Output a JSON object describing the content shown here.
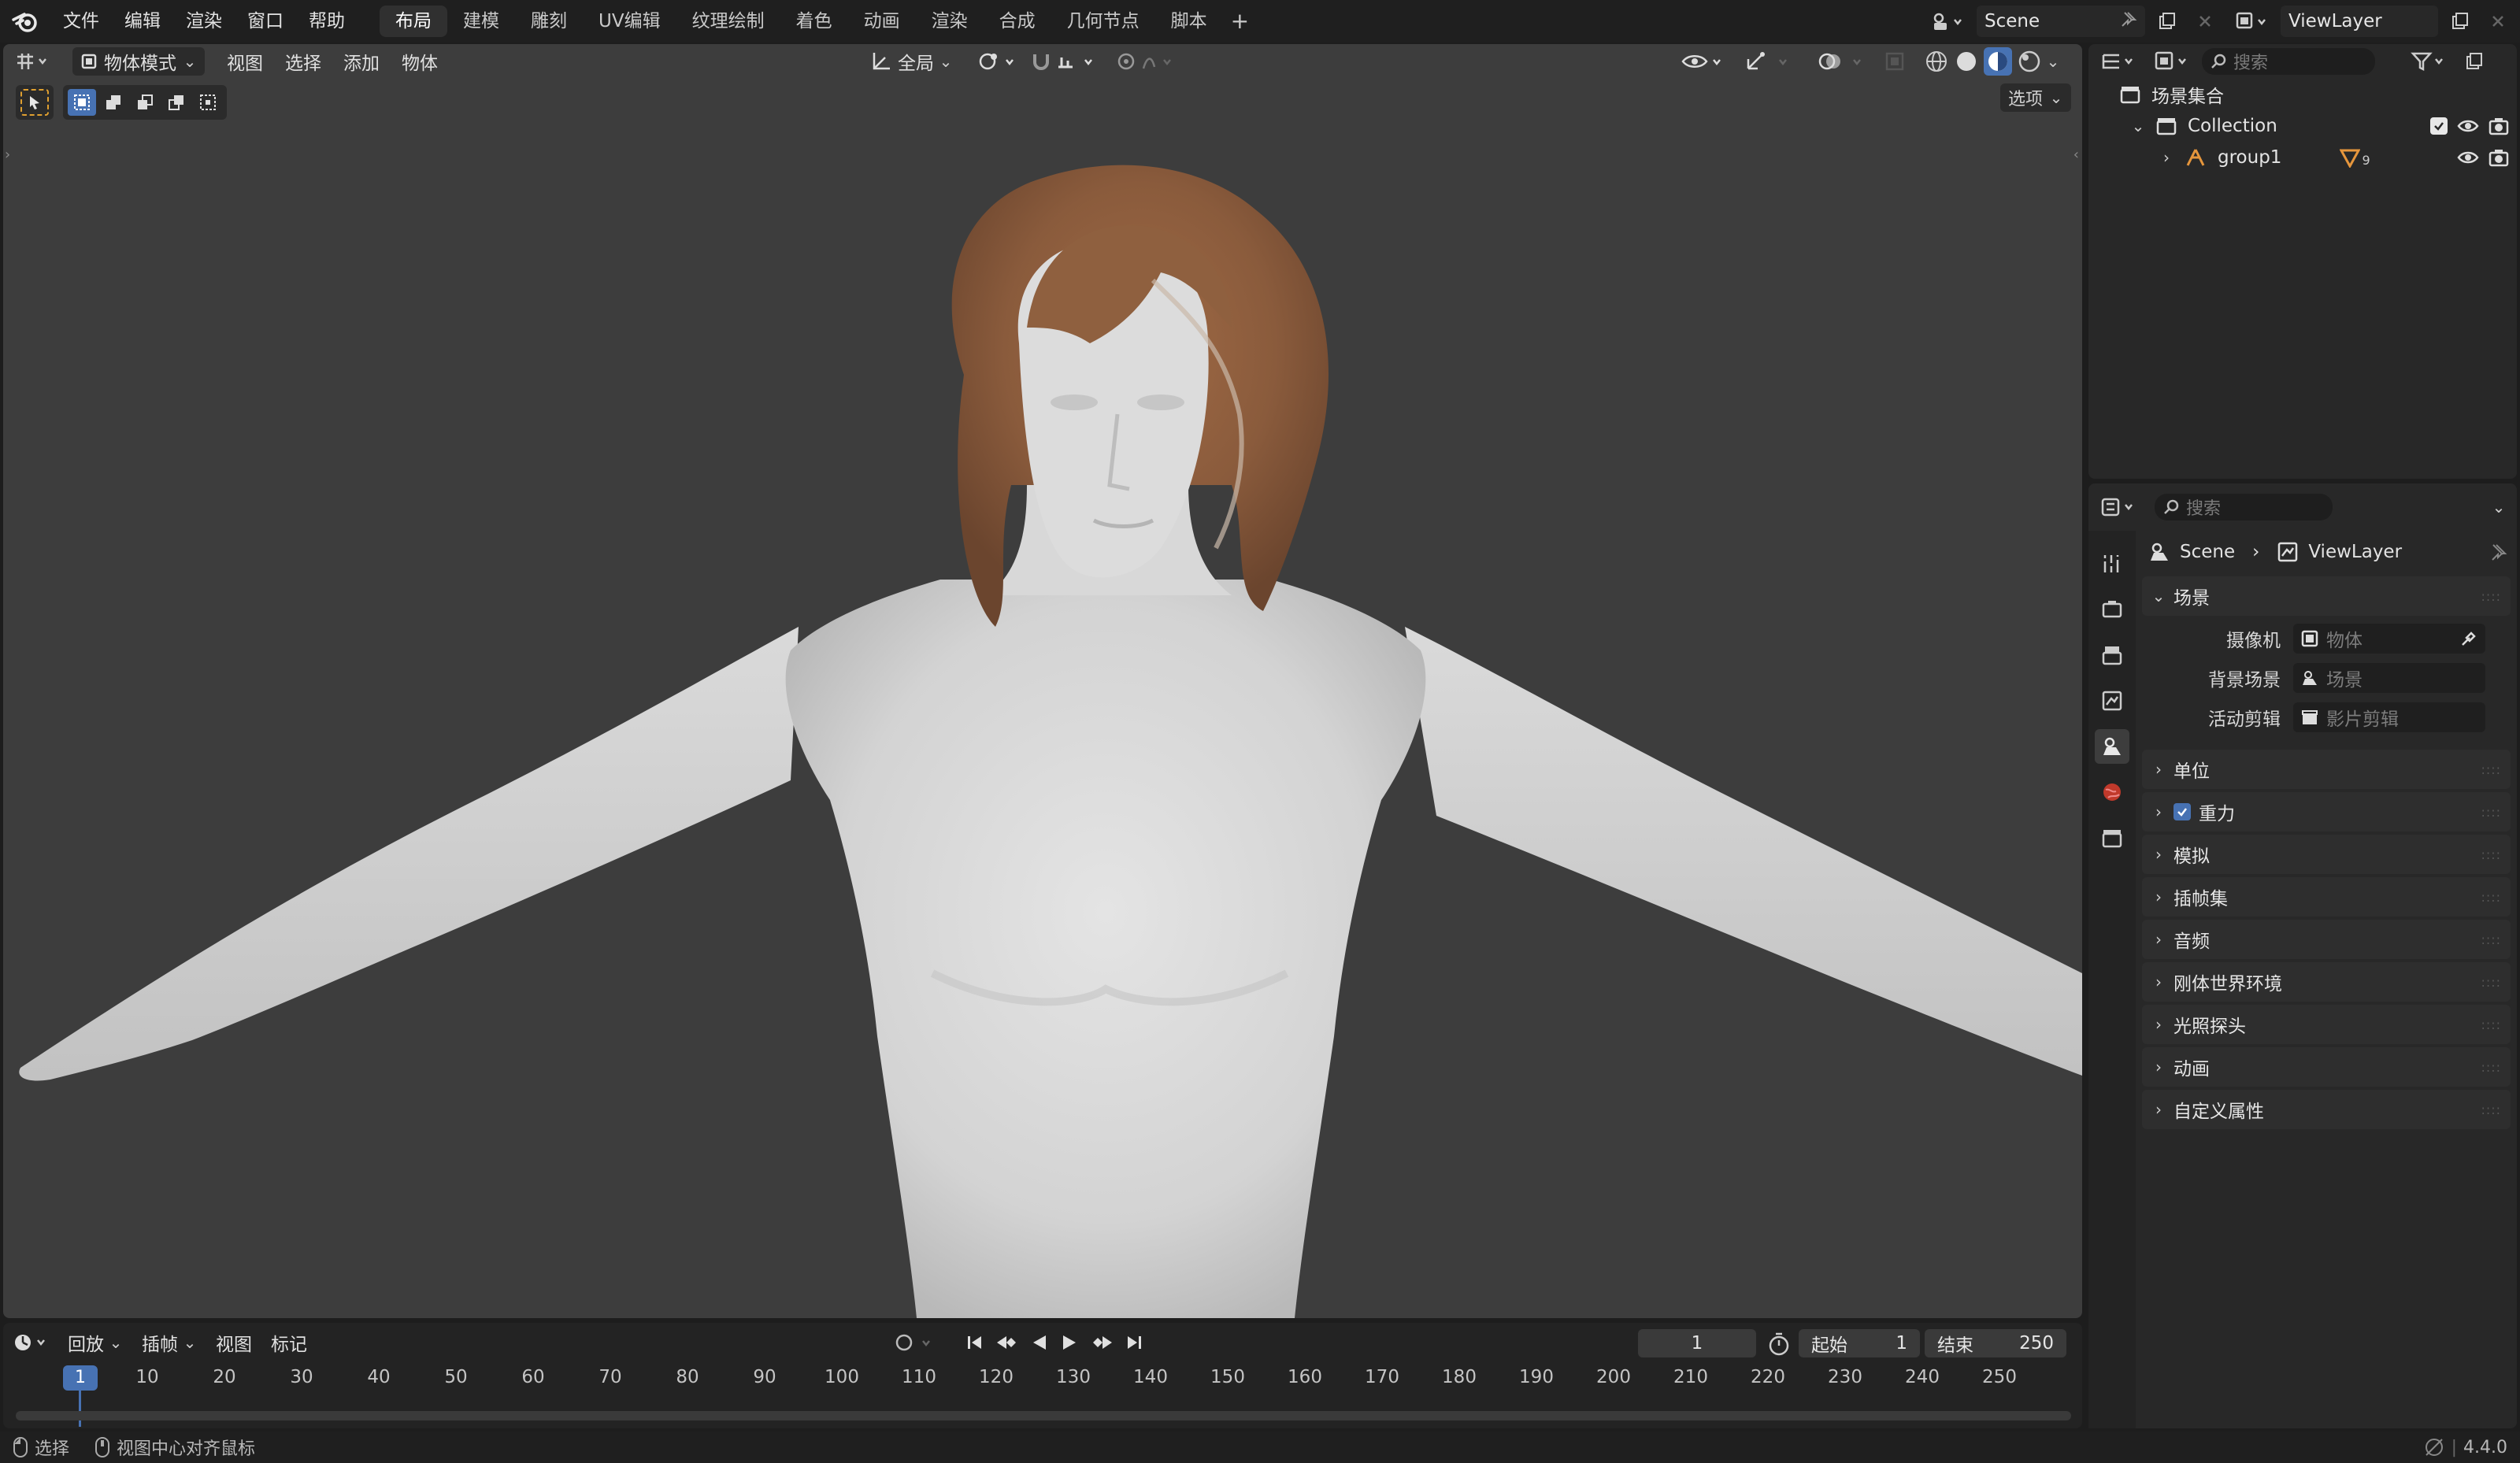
{
  "topbar": {
    "menus": [
      "文件",
      "编辑",
      "渲染",
      "窗口",
      "帮助"
    ],
    "workspace_tabs": [
      "布局",
      "建模",
      "雕刻",
      "UV编辑",
      "纹理绘制",
      "着色",
      "动画",
      "渲染",
      "合成",
      "几何节点",
      "脚本"
    ],
    "active_tab": "布局",
    "add_tab": "+",
    "scene_name": "Scene",
    "view_layer_name": "ViewLayer"
  },
  "viewport": {
    "mode": "物体模式",
    "menus": [
      "视图",
      "选择",
      "添加",
      "物体"
    ],
    "transform_orientation": "全局",
    "options": "选项"
  },
  "timeline": {
    "menus": [
      "回放",
      "插帧",
      "视图",
      "标记"
    ],
    "current_frame": "1",
    "start_label": "起始",
    "start_value": "1",
    "end_label": "结束",
    "end_value": "250",
    "ruler": [
      "1",
      "10",
      "20",
      "30",
      "40",
      "50",
      "60",
      "70",
      "80",
      "90",
      "100",
      "110",
      "120",
      "130",
      "140",
      "150",
      "160",
      "170",
      "180",
      "190",
      "200",
      "210",
      "220",
      "230",
      "240",
      "250"
    ]
  },
  "statusbar": {
    "left_action": "选择",
    "middle_action": "视图中心对齐鼠标",
    "version": "4.4.0"
  },
  "outliner": {
    "search_placeholder": "搜索",
    "root": "场景集合",
    "collection": "Collection",
    "object": "group1",
    "object_badge": "9"
  },
  "properties": {
    "search_placeholder": "搜索",
    "breadcrumb_scene": "Scene",
    "breadcrumb_viewlayer": "ViewLayer",
    "section": "场景",
    "rows": [
      {
        "label": "摄像机",
        "placeholder": "物体"
      },
      {
        "label": "背景场景",
        "placeholder": "场景"
      },
      {
        "label": "活动剪辑",
        "placeholder": "影片剪辑"
      }
    ],
    "panels": [
      "单位",
      "重力",
      "模拟",
      "插帧集",
      "音频",
      "刚体世界环境",
      "光照探头",
      "动画",
      "自定义属性"
    ]
  },
  "colors": {
    "accent": "#4772b3",
    "viewport_bg": "#3d3d3d",
    "panel_bg": "#282828",
    "skin": "#dadada",
    "hair": "#8a5b3c"
  }
}
